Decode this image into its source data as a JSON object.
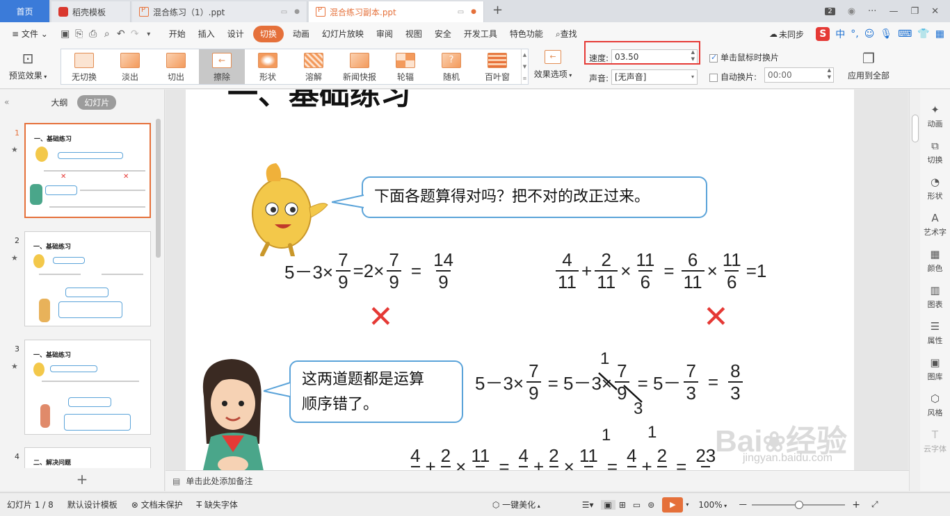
{
  "tabs": {
    "home": "首页",
    "items": [
      {
        "label": "稻壳模板"
      },
      {
        "label": "混合练习（1）.ppt"
      },
      {
        "label": "混合练习副本.ppt"
      }
    ],
    "new_tab": "+",
    "badge": "2",
    "more": "···"
  },
  "menu": {
    "file": "文件",
    "items": [
      "开始",
      "插入",
      "设计",
      "切换",
      "动画",
      "幻灯片放映",
      "审阅",
      "视图",
      "安全",
      "开发工具",
      "特色功能"
    ],
    "active": "切换",
    "search": "查找",
    "sync": "未同步",
    "ime": "中"
  },
  "ribbon": {
    "preview": "预览效果",
    "effects": [
      "无切换",
      "淡出",
      "切出",
      "擦除",
      "形状",
      "溶解",
      "新闻快报",
      "轮辐",
      "随机",
      "百叶窗"
    ],
    "selected_effect": "擦除",
    "effect_options": "效果选项",
    "speed_label": "速度:",
    "speed_value": "03.50",
    "sound_label": "声音:",
    "sound_value": "[无声音]",
    "click_advance": "单击鼠标时换片",
    "auto_advance": "自动换片:",
    "auto_time": "00:00",
    "apply_all": "应用到全部"
  },
  "left_pane": {
    "tab_outline": "大纲",
    "tab_slides": "幻灯片",
    "slides": [
      {
        "num": "1",
        "title": "一、基础练习"
      },
      {
        "num": "2",
        "title": "一、基础练习"
      },
      {
        "num": "3",
        "title": "一、基础练习"
      },
      {
        "num": "4",
        "title": "二、解决问题"
      }
    ],
    "add": "+"
  },
  "slide": {
    "title": "一、基础练习",
    "bubble1": "下面各题算得对吗？把不对的改正过来。",
    "bubble2_line1": "这两道题都是运算",
    "bubble2_line2": "顺序错了。",
    "eq1": {
      "a": "5－3×",
      "n1": "7",
      "d1": "9",
      "eq": "=2×",
      "n2": "7",
      "d2": "9",
      "eq2": "=",
      "n3": "14",
      "d3": "9"
    },
    "eq2": {
      "n1": "4",
      "d1": "11",
      "plus": "+",
      "n2": "2",
      "d2": "11",
      "times": "×",
      "n3": "11",
      "d3": "6",
      "eq": "=",
      "n4": "6",
      "d4": "11",
      "times2": "×",
      "n5": "11",
      "d5": "6",
      "res": "=1"
    },
    "eq3": {
      "a": "5－3×",
      "n1": "7",
      "d1": "9",
      "b": "= 5－3×",
      "n2": "7",
      "d2": "9",
      "c": "= 5－",
      "n3": "7",
      "d3": "3",
      "eq": "=",
      "n4": "8",
      "d4": "3",
      "over": "1",
      "under": "3"
    },
    "eq4": {
      "n1": "4",
      "plus": "+",
      "n2": "2",
      "times": "×",
      "n3": "11",
      "eq": "=",
      "n4": "4",
      "plus2": "+",
      "n5": "2",
      "times2": "×",
      "n6": "11",
      "eq2": "=",
      "n7": "4",
      "plus3": "+",
      "n8": "2",
      "eq3": "=",
      "n9": "23",
      "over1": "1",
      "over2": "1"
    },
    "wrong_mark": "✕"
  },
  "right_pane": [
    "动画",
    "切换",
    "形状",
    "艺术字",
    "颜色",
    "图表",
    "属性",
    "图库",
    "风格",
    "云字体"
  ],
  "notes": "单击此处添加备注",
  "status": {
    "slide_count": "幻灯片 1 / 8",
    "template": "默认设计模板",
    "protect": "文档未保护",
    "fonts": "缺失字体",
    "beautify": "一键美化",
    "zoom": "100%",
    "minus": "－",
    "plus": "+"
  },
  "colors": {
    "accent": "#e5703a",
    "home_tab": "#3b7bd9",
    "highlight_box": "#e53935",
    "bubble_border": "#5aa3d9"
  }
}
